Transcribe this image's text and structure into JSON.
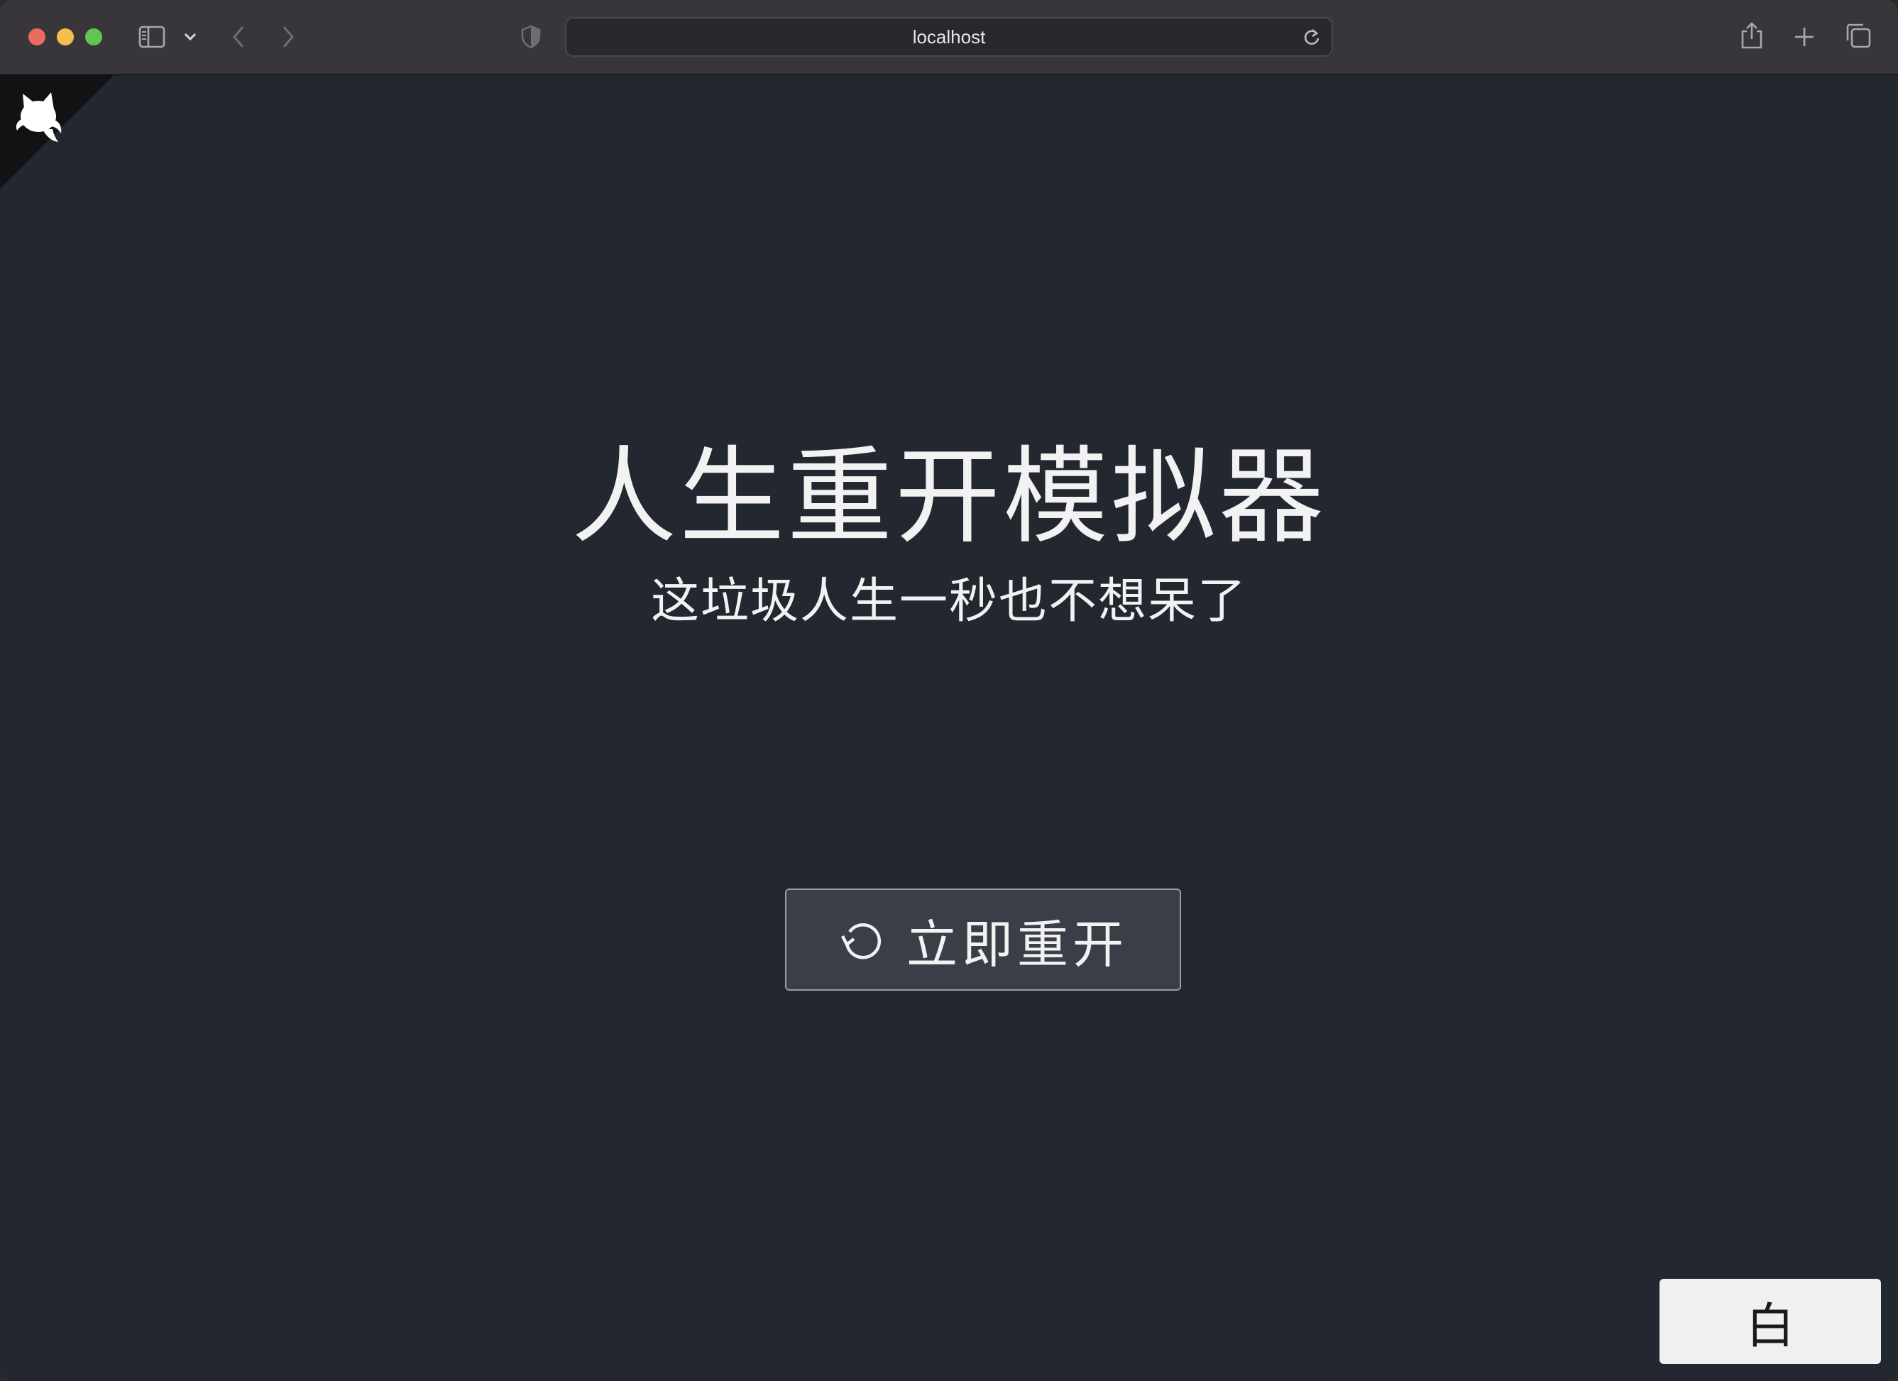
{
  "browser": {
    "url": "localhost",
    "icons": {
      "sidebar": "sidebar-icon",
      "sidebar_menu": "chevron-down-icon",
      "back": "chevron-left-icon",
      "forward": "chevron-right-icon",
      "privacy": "shield-icon",
      "reload": "reload-icon",
      "share": "share-icon",
      "new_tab": "plus-icon",
      "tab_overview": "tabs-icon"
    }
  },
  "page": {
    "corner_icon": "github-octocat-icon",
    "title": "人生重开模拟器",
    "subtitle": "这垃圾人生一秒也不想呆了",
    "restart_button": {
      "label": "立即重开",
      "icon": "restart-icon"
    },
    "theme_button": {
      "label": "白"
    },
    "colors": {
      "background": "#232730",
      "text": "#f2f2f2",
      "button_bg": "#3a3e47",
      "theme_button_bg": "#f0f0f0"
    }
  }
}
